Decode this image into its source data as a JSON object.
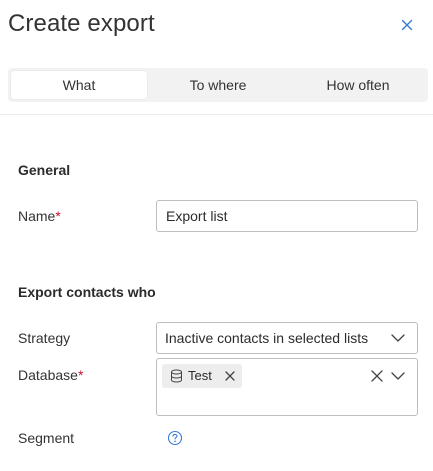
{
  "dialog": {
    "title": "Create export"
  },
  "tabs": [
    {
      "label": "What",
      "active": true
    },
    {
      "label": "To where",
      "active": false
    },
    {
      "label": "How often",
      "active": false
    }
  ],
  "general": {
    "heading": "General",
    "name_label": "Name",
    "required_mark": "*",
    "name_value": "Export list"
  },
  "export_contacts": {
    "heading": "Export contacts who",
    "strategy_label": "Strategy",
    "strategy_value": "Inactive contacts in selected lists",
    "database_label": "Database",
    "database_required_mark": "*",
    "database_chips": [
      {
        "label": "Test",
        "icon": "database-icon"
      }
    ],
    "segment_label": "Segment",
    "segment_help_icon": "question-circle-icon"
  },
  "colors": {
    "accent": "#3a7bd5",
    "required": "#c8102e",
    "tab_bg": "#f2f2f2",
    "chip_bg": "#ededed",
    "border": "#bdbdbd"
  }
}
